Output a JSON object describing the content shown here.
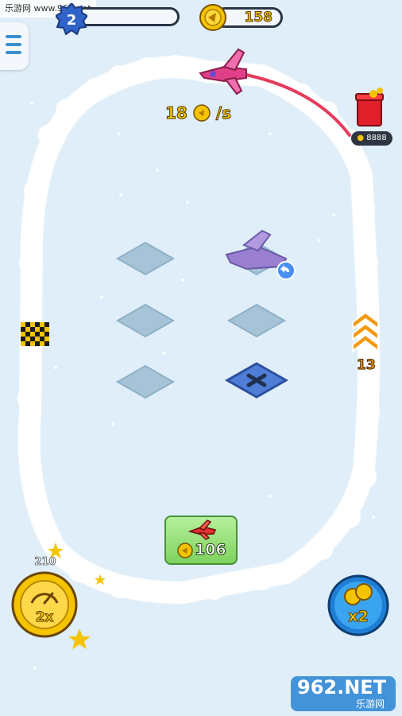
{
  "watermark": {
    "text": "乐游网 www.962.net"
  },
  "hud": {
    "level": "2",
    "xp_progress": 0.0,
    "coins": "158",
    "menu_icon": "hamburger-icon"
  },
  "income": {
    "amount": "18",
    "unit": "/s"
  },
  "gift": {
    "label": "8888",
    "icon": "gift-box-icon"
  },
  "speed": {
    "count": "13",
    "icon": "speed-up-chevrons-icon"
  },
  "hangar": {
    "slots": [
      "empty",
      "occupied",
      "empty",
      "empty",
      "empty",
      "locked"
    ]
  },
  "shop": {
    "price": "106",
    "icon": "red-plane-icon"
  },
  "boost": {
    "count": "210",
    "label": "2x",
    "icon": "speedometer-icon"
  },
  "double_coins": {
    "label": "x2",
    "icon": "coin-stack-icon"
  },
  "site_logo": {
    "big": "962.NET",
    "small": "乐游网"
  },
  "colors": {
    "sky": "#dfeef8",
    "coin": "#f7c900",
    "boost_ring": "#f5c400",
    "x2_ring": "#1f7fd4",
    "buy_button": "#8edc6c",
    "trail": "#e2264a"
  }
}
